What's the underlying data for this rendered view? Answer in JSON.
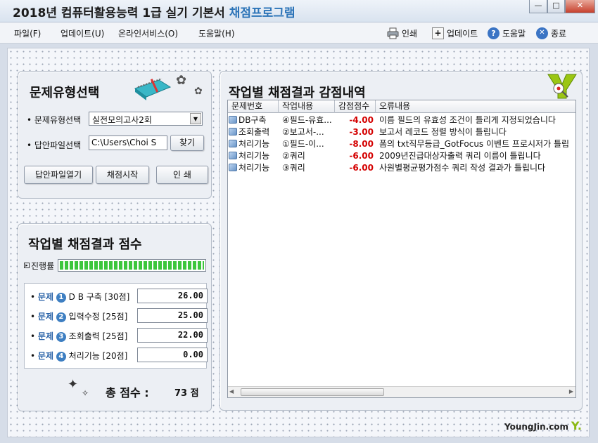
{
  "app": {
    "title_main": "2018년 컴퓨터활용능력 1급 실기 기본서",
    "title_accent": "채점프로그램"
  },
  "window": {
    "minimize": "—",
    "maximize": "□",
    "close": "✕"
  },
  "menu": [
    "파일(F)",
    "업데이트(U)",
    "온라인서비스(O)",
    "도움말(H)"
  ],
  "toolbar": {
    "print": "인쇄",
    "update": "업데이트",
    "help": "도움말",
    "exit": "종료"
  },
  "select_panel": {
    "title": "문제유형선택",
    "type_label": "• 문제유형선택",
    "type_value": "실전모의고사2회",
    "file_label": "• 답안파일선택",
    "file_value": "C:\\Users\\Choi S",
    "browse_button": "찾기",
    "open_button": "답안파일열기",
    "start_button": "채점시작",
    "print_button": "인    쇄"
  },
  "score_panel": {
    "title": "작업별 채점결과 점수",
    "progress_label": "진행률",
    "progress": 1.0,
    "q_word": "문제",
    "rows": [
      {
        "num": "1",
        "label": "D B 구축 [30점]",
        "score": "26.00"
      },
      {
        "num": "2",
        "label": "입력수정 [25점]",
        "score": "25.00"
      },
      {
        "num": "3",
        "label": "조회출력 [25점]",
        "score": "22.00"
      },
      {
        "num": "4",
        "label": "처리기능 [20점]",
        "score": "0.00"
      }
    ],
    "total_label": "총 점수 :",
    "total_value": "73 점"
  },
  "result_panel": {
    "title": "작업별 채점결과  감점내역",
    "columns": [
      "문제번호",
      "작업내용",
      "감점점수",
      "오류내용"
    ],
    "rows": [
      {
        "no": "DB구축",
        "task": "④필드-유효...",
        "deduct": "-4.00",
        "error": "이름 필드의 유효성 조건이 틀리게 지정되었습니다"
      },
      {
        "no": "조회출력",
        "task": "②보고서-...",
        "deduct": "-3.00",
        "error": "보고서 레코드 정렬 방식이 틀립니다"
      },
      {
        "no": "처리기능",
        "task": "①필드-이...",
        "deduct": "-8.00",
        "error": "폼의 txt직무등급_GotFocus 이벤트 프로시저가 틀립"
      },
      {
        "no": "처리기능",
        "task": "②쿼리",
        "deduct": "-6.00",
        "error": "2009년진급대상자출력 쿼리 이름이 틀립니다"
      },
      {
        "no": "처리기능",
        "task": "③쿼리",
        "deduct": "-6.00",
        "error": "사원별평균평가점수 쿼리 작성 결과가 틀립니다"
      }
    ]
  },
  "brand": {
    "text": "YoungJin.com",
    "mark": "Y."
  }
}
